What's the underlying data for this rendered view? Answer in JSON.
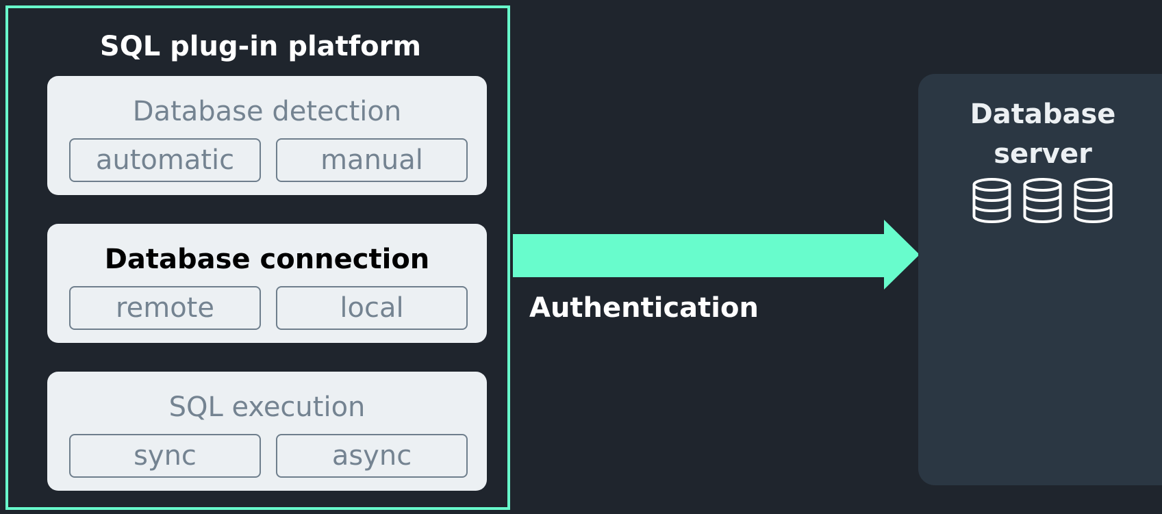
{
  "platform": {
    "title": "SQL plug-in platform",
    "sections": [
      {
        "title": "Database detection",
        "options": [
          "automatic",
          "manual"
        ],
        "highlighted": false
      },
      {
        "title": "Database connection",
        "options": [
          "remote",
          "local"
        ],
        "highlighted": true
      },
      {
        "title": "SQL execution",
        "options": [
          "sync",
          "async"
        ],
        "highlighted": false
      }
    ]
  },
  "arrow": {
    "label": "Authentication"
  },
  "server": {
    "title_line1": "Database",
    "title_line2": "server",
    "icons": [
      "database-icon",
      "database-icon",
      "database-icon"
    ]
  },
  "colors": {
    "background": "#1f252d",
    "accent": "#68fccc",
    "card": "#ecf0f3",
    "muted_text": "#748391",
    "server_panel": "#2b3743"
  }
}
